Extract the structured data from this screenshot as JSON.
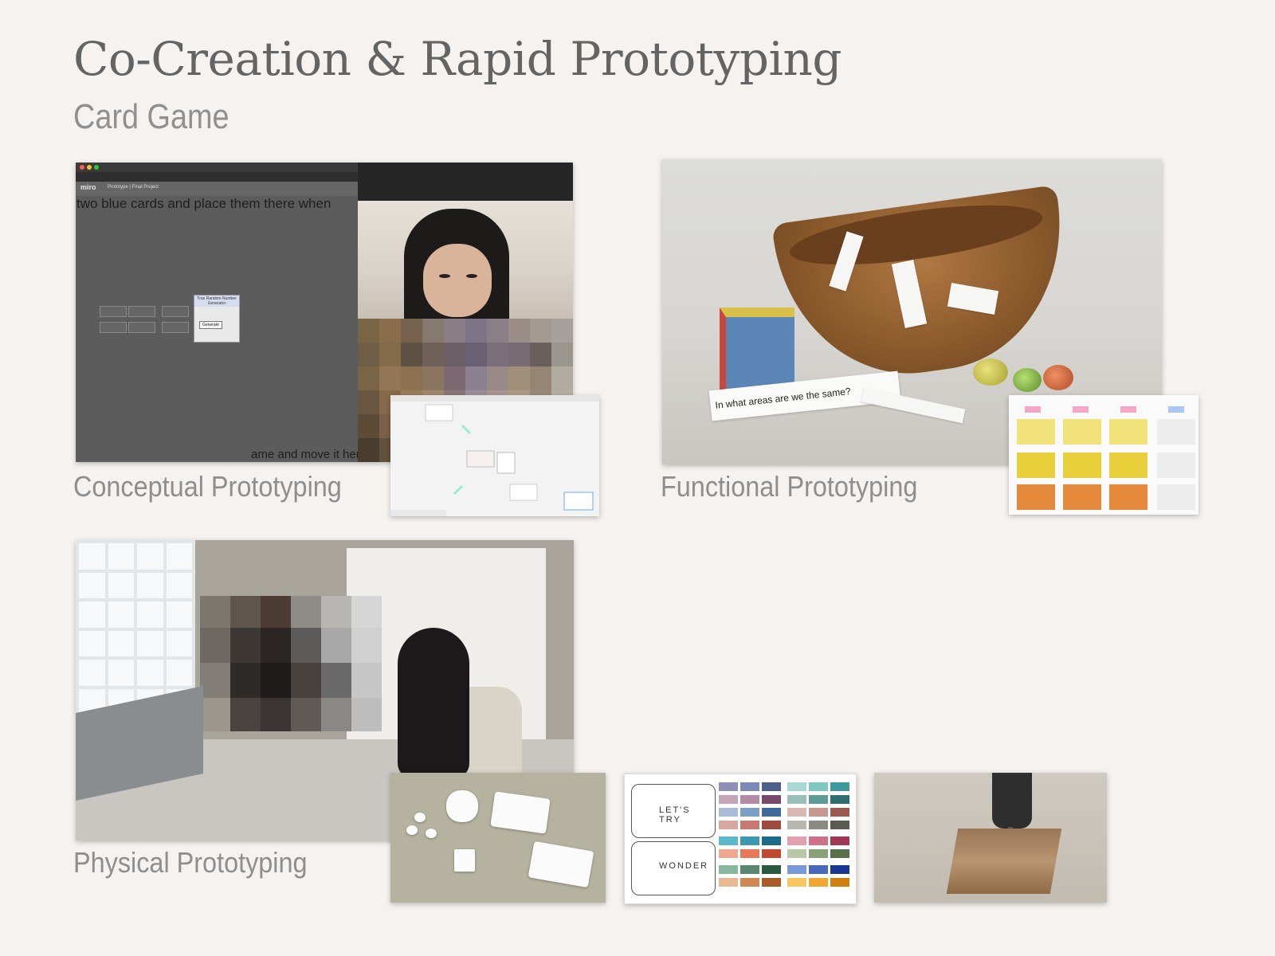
{
  "header": {
    "title": "Co-Creation & Rapid Prototyping",
    "subtitle": "Card Game"
  },
  "sections": {
    "conceptual": "Conceptual Prototyping",
    "functional": "Functional Prototyping",
    "physical": "Physical Prototyping"
  },
  "conceptual_screenshot": {
    "app_logo": "miro",
    "doc_title": "Prototype | Final Project",
    "caption_top": "two blue cards and place them there when",
    "caption_bottom": "ame and move it here",
    "dialog_title": "True Random Number Generator",
    "dialog_button": "Generate"
  },
  "functional_photo": {
    "question_text": "In what areas are we the same?"
  },
  "palette_photo": {
    "card1_label": "LET'S TRY",
    "card2_label": "WONDER"
  },
  "colors": {
    "background": "#f5f2ef",
    "title": "#646464",
    "subtitle": "#909090",
    "caption": "#8e8e8e"
  }
}
